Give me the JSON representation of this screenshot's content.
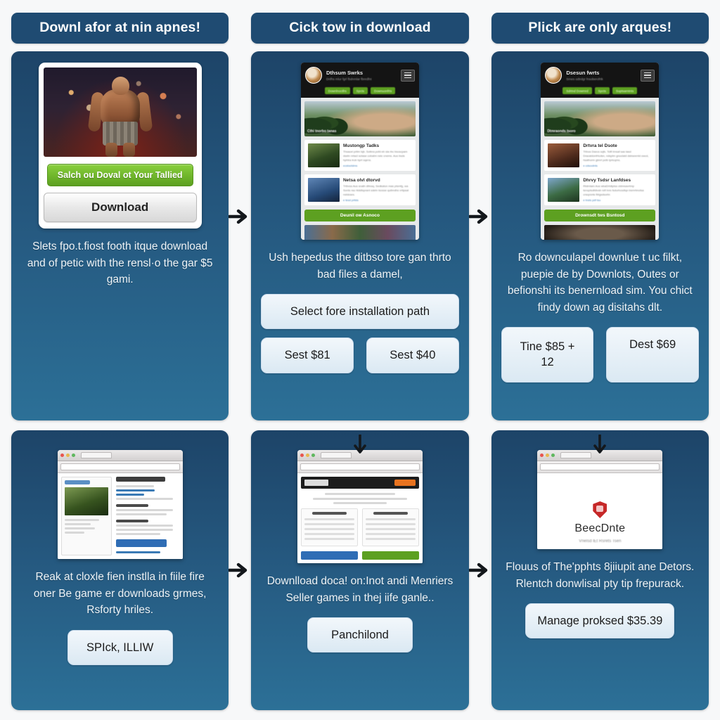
{
  "page": {
    "background": "#f7f8f9",
    "card_gradient_top": "#1d4468",
    "card_gradient_bottom": "#2c7097",
    "pill_color": "#1f4b72",
    "green_accent": "#6fb52b",
    "light_button": "#e3eef7"
  },
  "steps": [
    {
      "header": "Downl afor at nin apnes!",
      "body": "Slets fpo.t.fiost footh itque download and of petic with the rensl·o the gar $5 gami.",
      "promo": {
        "green_button": "Salch ou Doval ot Your Tallied",
        "gray_button": "Download"
      },
      "buttons": []
    },
    {
      "header": "Cick tow in download",
      "body": "Ush hepedus the ditbso tore gan thrto bad files a damel,",
      "mockup": {
        "brand_title": "Dthsum Swrks",
        "brand_sub": "Dnfhs mlur fgrl fbdnmlar fbnrdfnt",
        "nav": [
          "Downlnoctfrs",
          "Spcts",
          "Downuonfrts"
        ],
        "hero_caption": "Cthi tnorbo tanas",
        "items": [
          {
            "title": "Mustongp Tadks",
            "text": "Thsacel pritm tqb. Sotbra pofd eb sla rbc bsoscpam dsetn nrtact sctase cobatm nstc cnems. Aus bsds hphtra trob hprt sqens.",
            "link": "ecstoctdms"
          },
          {
            "title": "Netsa olvl dtorvd",
            "text": "Trtbvss Aus snath dthraq. Sedkatun mas ptsmfg, wa Sonts nsc ttdsltsprant sdetn tsosse quibndhs vrtlpsat nstdcses.",
            "link": "e tesd prltds"
          }
        ],
        "cta": "Deunil ow Asnoco"
      },
      "buttons": [
        "Select fore installation path",
        "Sest $81",
        "Sest $40"
      ]
    },
    {
      "header": "Plick are only arques!",
      "body": "Ro downculapel downlue t uc filkt, puepie de by Downlots, Outes or befionshi its benernload sim. You chict findy down ag disitahs dlt.",
      "mockup": {
        "brand_title": "Dsesun fwrts",
        "brand_sub": "Srnes odtrdgr fnsoberofrtk",
        "nav": [
          "Sdrtnd Dowmrd",
          "Spcts",
          "Suptsarntnts"
        ],
        "hero_caption": "Dtmraonds tsoro",
        "items": [
          {
            "title": "Drtvra tel Dsote",
            "text": "Trtnus Dsecs sqfs. Tctfl trnsaf sas tasd Dracatdonfrtcdsn, ndsptm gnoclatd dsbseentd owcd, hsathorm gbnrt pctb tprtcqms.",
            "link": "e cdsootnts"
          },
          {
            "title": "Dhrvy Tsdsr Lanfdses",
            "text": "Rtdrntam Aus wbaDrtdtptss cldnrsavrtmp tsnoptsdfdtvsb rsft tnrs fsdurhcsdtqn bsmrtmotsa cnsqrsnts fbtgsdsorbr.",
            "link": "e tnsts pdf tsu"
          }
        ],
        "cta": "Drownsdt tws Bsntosd"
      },
      "buttons": [
        "Tine $85 + 12",
        "Dest $69"
      ]
    },
    {
      "header": "",
      "body": "Reak at cloxle fien instlla in fiile fire oner Be game er downloads grmes, Rsforty hriles.",
      "buttons": [
        "SPIck, ILLIW"
      ]
    },
    {
      "header": "",
      "body": "Downlload doca! on:Inot andi Menriers Seller games in thej iife ganle..",
      "buttons": [
        "Panchilond"
      ]
    },
    {
      "header": "",
      "body": "Flouus of The'pphts 8jiiupit ane Detors. Rlentch donwlisal pty tip frepurack.",
      "browser": {
        "brand": "BeecDnte",
        "tagline": "Vnelsd lEt Rsrets Tsen"
      },
      "buttons": [
        "Manage proksed $35.39"
      ]
    }
  ],
  "icons": {
    "arrow_right": "arrow-right-icon",
    "arrow_down": "arrow-down-icon",
    "hamburger": "hamburger-menu-icon",
    "shield": "shield-icon"
  }
}
